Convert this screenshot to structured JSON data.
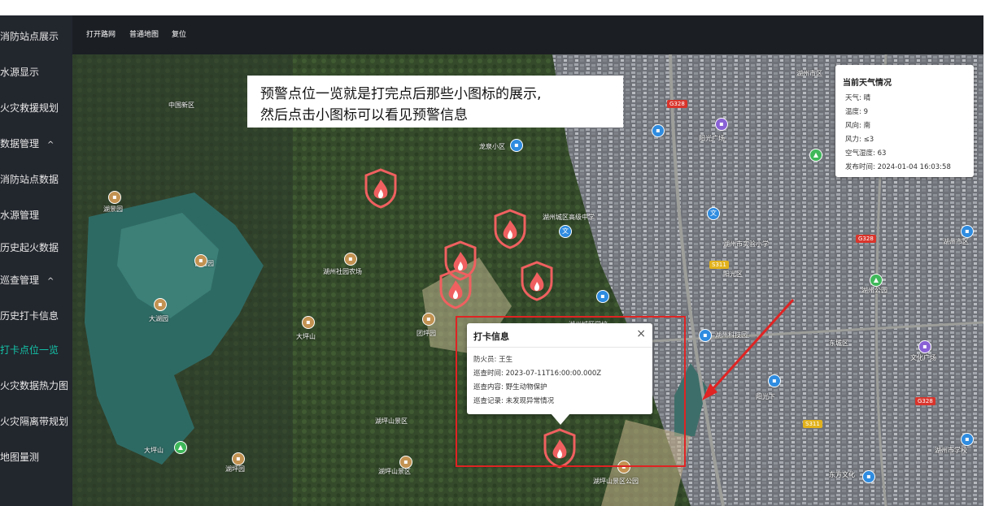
{
  "sidebar": {
    "items": [
      {
        "label": "消防站点展示"
      },
      {
        "label": "水源显示"
      },
      {
        "label": "火灾救援规划"
      },
      {
        "label": "数据管理",
        "chevron": "^"
      },
      {
        "label": "消防站点数据"
      },
      {
        "label": "水源管理"
      },
      {
        "label": "历史起火数据"
      },
      {
        "label": "巡查管理",
        "chevron": "^"
      },
      {
        "label": "历史打卡信息"
      },
      {
        "label": "打卡点位一览"
      },
      {
        "label": "火灾数据热力图"
      },
      {
        "label": "火灾隔离带规划"
      },
      {
        "label": "地图量测"
      }
    ],
    "active_color": "#14c3a8"
  },
  "topbar": {
    "buttons": [
      "打开路网",
      "普通地图",
      "复位"
    ]
  },
  "annotation": {
    "line1": "预警点位一览就是打完点后那些小图标的展示,",
    "line2": "然后点击小图标可以看见预警信息"
  },
  "weather": {
    "title": "当前天气情况",
    "rows": [
      {
        "label": "天气:",
        "value": "晴"
      },
      {
        "label": "温度:",
        "value": "9"
      },
      {
        "label": "风向:",
        "value": "南"
      },
      {
        "label": "风力:",
        "value": "≤3"
      },
      {
        "label": "空气湿度:",
        "value": "63"
      },
      {
        "label": "发布时间:",
        "value": "2024-01-04 16:03:58"
      }
    ]
  },
  "popup": {
    "title": "打卡信息",
    "close": "×",
    "rows": [
      {
        "label": "防火员:",
        "value": "王生"
      },
      {
        "label": "巡查时间:",
        "value": "2023-07-11T16:00:00.000Z"
      },
      {
        "label": "巡查内容:",
        "value": "野生动物保护"
      },
      {
        "label": "巡查记录:",
        "value": "未发现异常情况"
      }
    ]
  },
  "map": {
    "road_badges": [
      "G328",
      "G328",
      "G328",
      "S311",
      "S311"
    ],
    "icons": [
      "fire-warning-icon",
      "museum-icon",
      "school-icon",
      "park-icon",
      "bank-icon"
    ],
    "accent_red": "#e02323",
    "fire_color": "#f06060"
  }
}
